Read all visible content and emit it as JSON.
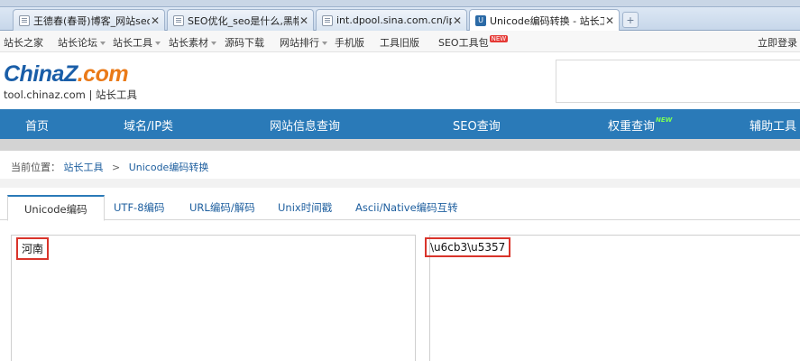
{
  "browser": {
    "tabs": [
      {
        "title": "王德春(春哥)博客_网站seo,se",
        "active": false,
        "icon": "page-icon"
      },
      {
        "title": "SEO优化_seo是什么,黑帽seo",
        "active": false,
        "icon": "page-icon"
      },
      {
        "title": "int.dpool.sina.com.cn/iploo",
        "active": false,
        "icon": "page-icon"
      },
      {
        "title": "Unicode编码转换 - 站长工具",
        "active": true,
        "icon": "unicode-icon"
      }
    ],
    "close_glyph": "✕",
    "new_tab_glyph": "+"
  },
  "site_nav": {
    "items": [
      "站长之家",
      "站长论坛",
      "站长工具",
      "站长素材",
      "源码下载",
      "网站排行",
      "手机版",
      "工具旧版",
      "SEO工具包"
    ],
    "new_badge": "NEW",
    "login": "立即登录"
  },
  "logo": {
    "brand_a": "China",
    "brand_z": "Z",
    "brand_b": ".com",
    "domain": "tool.chinaz.com",
    "divider": "|",
    "tagline": "站长工具"
  },
  "main_nav": {
    "items": [
      "首页",
      "域名/IP类",
      "网站信息查询",
      "SEO查询",
      "权重查询",
      "辅助工具"
    ],
    "new_label": "NEW"
  },
  "breadcrumb": {
    "prefix": "当前位置：",
    "link": "站长工具",
    "sep": ">",
    "current": "Unicode编码转换"
  },
  "tool_tabs": [
    "Unicode编码",
    "UTF-8编码",
    "URL编码/解码",
    "Unix时间戳",
    "Ascii/Native编码互转"
  ],
  "converter": {
    "input": "河南",
    "output": "\\u6cb3\\u5357"
  },
  "colors": {
    "brand_blue": "#2a7ab8",
    "highlight_red": "#d9342b",
    "logo_orange": "#ea7a18"
  }
}
